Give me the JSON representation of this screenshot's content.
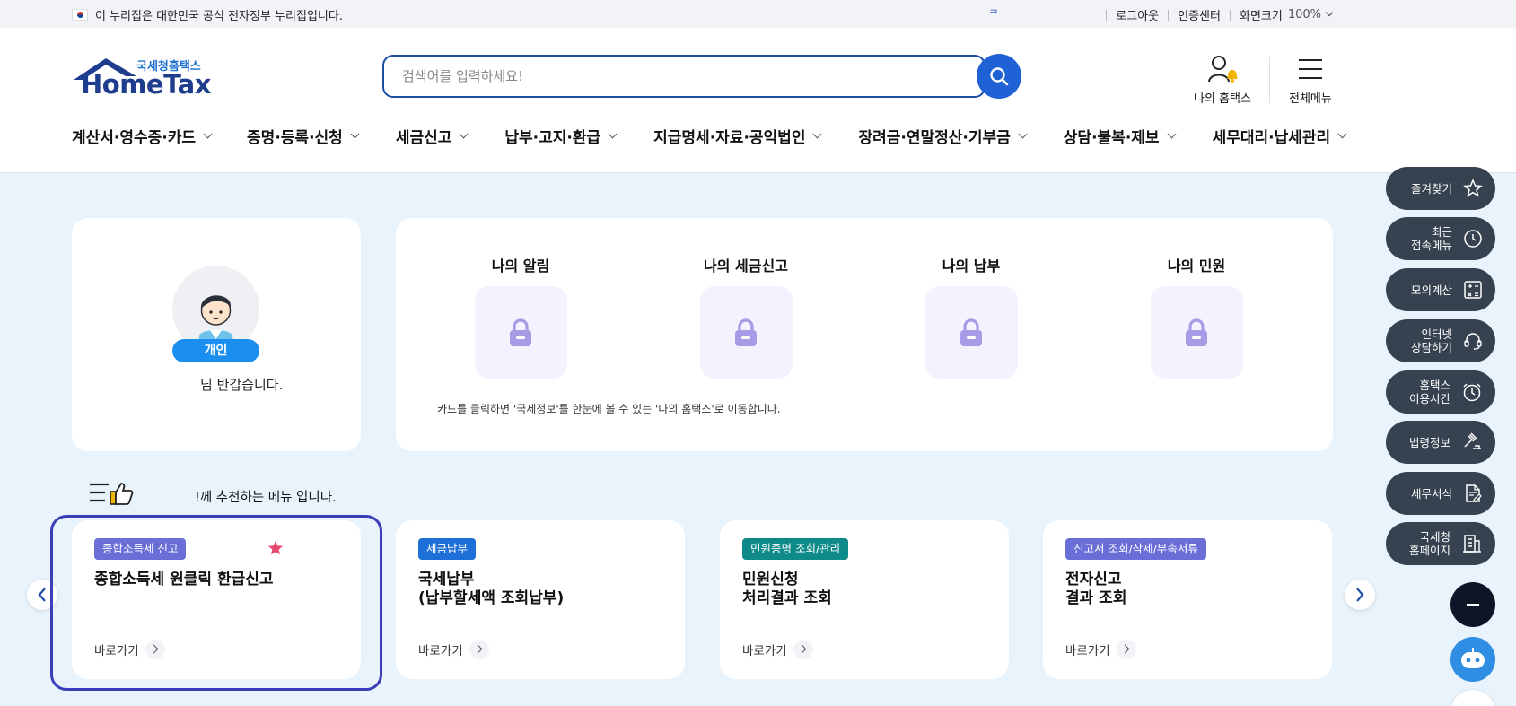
{
  "topbar": {
    "gov_notice": "이 누리집은 대한민국 공식 전자정부 누리집입니다.",
    "mark": "ᄏ",
    "logout": "로그아웃",
    "cert_center": "인증센터",
    "zoom_label": "화면크기",
    "zoom_value": "100%"
  },
  "logo": {
    "sub": "국세청홈택스",
    "main": "HomeTax"
  },
  "search": {
    "placeholder": "검색어를 입력하세요!"
  },
  "header": {
    "my_hometax": "나의 홈택스",
    "all_menu": "전체메뉴"
  },
  "nav": {
    "items": [
      "계산서·영수증·카드",
      "증명·등록·신청",
      "세금신고",
      "납부·고지·환급",
      "지급명세·자료·공익법인",
      "장려금·연말정산·기부금",
      "상담·불복·제보",
      "세무대리·납세관리"
    ]
  },
  "profile": {
    "badge": "개인",
    "greeting": "님 반갑습니다."
  },
  "mine": {
    "items": [
      "나의 알림",
      "나의 세금신고",
      "나의 납부",
      "나의 민원"
    ],
    "note": "카드를 클릭하면 '국세정보'를 한눈에 볼 수 있는 '나의 홈택스'로 이동합니다."
  },
  "recommend": {
    "text": "!께 추천하는 메뉴 입니다."
  },
  "services": [
    {
      "tag": "종합소득세 신고",
      "tag_color": "#6a6fd8",
      "title": "종합소득세 원클릭 환급신고",
      "go": "바로가기"
    },
    {
      "tag": "세금납부",
      "tag_color": "#1f6fd8",
      "title": "국세납부\n(납부할세액 조회납부)",
      "go": "바로가기"
    },
    {
      "tag": "민원증명 조회/관리",
      "tag_color": "#0f8a8a",
      "title": "민원신청\n처리결과 조회",
      "go": "바로가기"
    },
    {
      "tag": "신고서 조회/삭제/부속서류",
      "tag_color": "#6a6fd8",
      "title": "전자신고\n결과 조회",
      "go": "바로가기"
    }
  ],
  "quick_menu": [
    {
      "label": "즐겨찾기",
      "icon": "star-icon"
    },
    {
      "label": "최근\n접속메뉴",
      "icon": "clock-icon"
    },
    {
      "label": "모의계산",
      "icon": "calculator-icon"
    },
    {
      "label": "인터넷\n상담하기",
      "icon": "headset-icon"
    },
    {
      "label": "홈택스\n이용시간",
      "icon": "alarm-icon"
    },
    {
      "label": "법령정보",
      "icon": "gavel-icon"
    },
    {
      "label": "세무서식",
      "icon": "document-icon"
    },
    {
      "label": "국세청\n홈페이지",
      "icon": "building-icon"
    }
  ],
  "colors": {
    "brand_navy": "#1f3d8e",
    "brand_blue": "#1e62d6",
    "page_bg": "#e8f3fc",
    "quick_bg": "#36424f",
    "highlight": "#3a3fb8"
  }
}
